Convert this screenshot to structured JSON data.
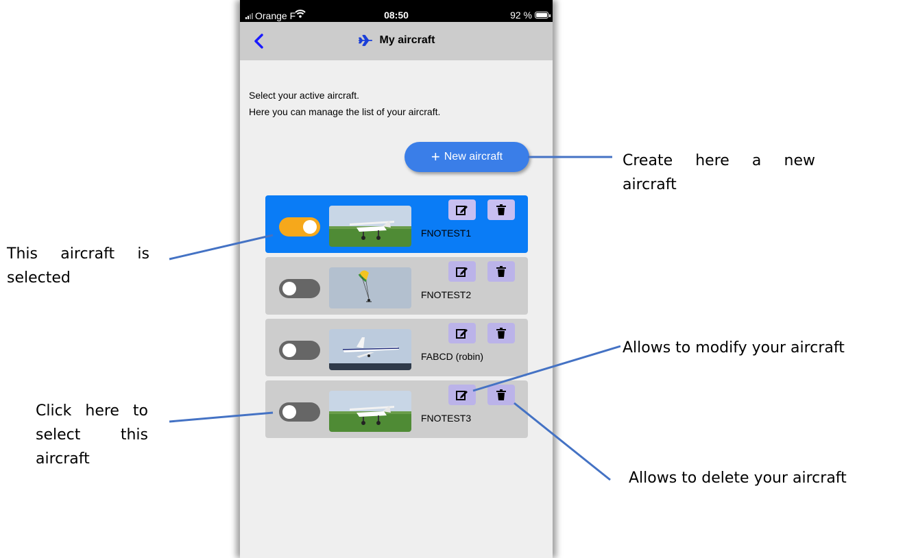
{
  "status_bar": {
    "carrier": "Orange F",
    "time": "08:50",
    "battery": "92 %"
  },
  "header": {
    "title": "My aircraft",
    "back_icon": "chevron-left-icon",
    "title_icon": "plane-icon"
  },
  "intro": {
    "line1": "Select your active aircraft.",
    "line2": "Here you can manage the list of your aircraft."
  },
  "new_button": {
    "label": "New aircraft",
    "icon": "plus-icon"
  },
  "aircraft": [
    {
      "registration": "FNOTEST1",
      "active": true
    },
    {
      "registration": "FNOTEST2",
      "active": false
    },
    {
      "registration": "FABCD (robin)",
      "active": false
    },
    {
      "registration": "FNOTEST3",
      "active": false
    }
  ],
  "callouts": {
    "create": "Create here a new aircraft",
    "selected": "This aircraft is selected",
    "click_select": "Click here to select this aircraft",
    "modify": "Allows to modify your aircraft",
    "delete": "Allows to delete your aircraft"
  },
  "colors": {
    "selected_row": "#0a7cf6",
    "toggle_on": "#f6a81b",
    "primary_button": "#3a7ee8",
    "action_button": "#bbb3e9",
    "callout_line": "#4472c4"
  }
}
